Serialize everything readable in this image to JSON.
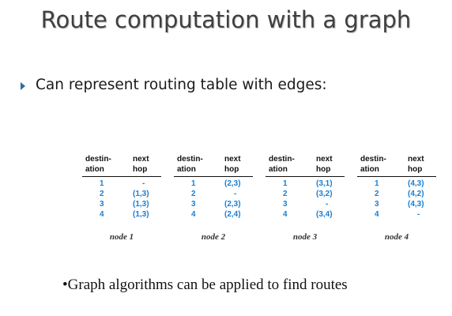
{
  "slide": {
    "title": "Route computation with a graph",
    "bullet": "Can represent routing table with edges:",
    "footer": "•Graph algorithms can be applied to find routes",
    "accent_color": "#2b6fa0",
    "table_value_color": "#1a7fd4"
  },
  "tables": [
    {
      "header": {
        "dest_line1": "destin-",
        "dest_line2": "ation",
        "hop_line1": "next",
        "hop_line2": "hop"
      },
      "rows": [
        {
          "dest": "1",
          "hop": "-"
        },
        {
          "dest": "2",
          "hop": "(1,3)"
        },
        {
          "dest": "3",
          "hop": "(1,3)"
        },
        {
          "dest": "4",
          "hop": "(1,3)"
        }
      ],
      "caption": "node 1"
    },
    {
      "header": {
        "dest_line1": "destin-",
        "dest_line2": "ation",
        "hop_line1": "next",
        "hop_line2": "hop"
      },
      "rows": [
        {
          "dest": "1",
          "hop": "(2,3)"
        },
        {
          "dest": "2",
          "hop": "-"
        },
        {
          "dest": "3",
          "hop": "(2,3)"
        },
        {
          "dest": "4",
          "hop": "(2,4)"
        }
      ],
      "caption": "node 2"
    },
    {
      "header": {
        "dest_line1": "destin-",
        "dest_line2": "ation",
        "hop_line1": "next",
        "hop_line2": "hop"
      },
      "rows": [
        {
          "dest": "1",
          "hop": "(3,1)"
        },
        {
          "dest": "2",
          "hop": "(3,2)"
        },
        {
          "dest": "3",
          "hop": "-"
        },
        {
          "dest": "4",
          "hop": "(3,4)"
        }
      ],
      "caption": "node 3"
    },
    {
      "header": {
        "dest_line1": "destin-",
        "dest_line2": "ation",
        "hop_line1": "next",
        "hop_line2": "hop"
      },
      "rows": [
        {
          "dest": "1",
          "hop": "(4,3)"
        },
        {
          "dest": "2",
          "hop": "(4,2)"
        },
        {
          "dest": "3",
          "hop": "(4,3)"
        },
        {
          "dest": "4",
          "hop": "-"
        }
      ],
      "caption": "node 4"
    }
  ]
}
